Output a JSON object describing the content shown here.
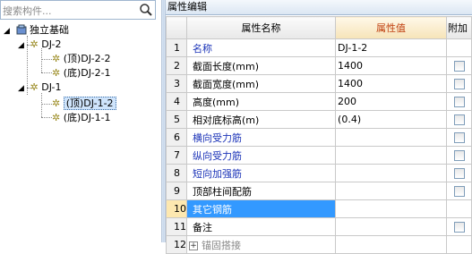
{
  "search": {
    "placeholder": "搜索构件..."
  },
  "tree": {
    "root": "独立基础",
    "groups": [
      {
        "label": "DJ-2",
        "children": [
          "(顶)DJ-2-2",
          "(底)DJ-2-1"
        ]
      },
      {
        "label": "DJ-1",
        "children": [
          "(顶)DJ-1-2",
          "(底)DJ-1-1"
        ]
      }
    ],
    "selected": "(顶)DJ-1-2"
  },
  "panel": {
    "title": "属性编辑"
  },
  "grid": {
    "headers": {
      "name": "属性名称",
      "value": "属性值",
      "extra": "附加"
    },
    "rows": [
      {
        "no": "1",
        "name": "名称",
        "value": "DJ-1-2",
        "style": "blue",
        "check": false
      },
      {
        "no": "2",
        "name": "截面长度(mm)",
        "value": "1400",
        "style": "normal",
        "check": true
      },
      {
        "no": "3",
        "name": "截面宽度(mm)",
        "value": "1400",
        "style": "normal",
        "check": true
      },
      {
        "no": "4",
        "name": "高度(mm)",
        "value": "200",
        "style": "normal",
        "check": true
      },
      {
        "no": "5",
        "name": "相对底标高(m)",
        "value": "(0.4)",
        "style": "normal",
        "check": true
      },
      {
        "no": "6",
        "name": "横向受力筋",
        "value": "",
        "style": "blue",
        "check": true
      },
      {
        "no": "7",
        "name": "纵向受力筋",
        "value": "",
        "style": "blue",
        "check": true
      },
      {
        "no": "8",
        "name": "短向加强筋",
        "value": "",
        "style": "blue",
        "check": true
      },
      {
        "no": "9",
        "name": "顶部柱间配筋",
        "value": "",
        "style": "normal",
        "check": true
      },
      {
        "no": "10",
        "name": "其它钢筋",
        "value": "",
        "style": "normal",
        "check": false
      },
      {
        "no": "11",
        "name": "备注",
        "value": "",
        "style": "normal",
        "check": true
      },
      {
        "no": "12",
        "name": "锚固搭接",
        "value": "",
        "style": "gray",
        "check": false
      }
    ]
  },
  "colors": {
    "accent": "#3399ff",
    "value_header": "#c04010",
    "link_text": "#1c34b8"
  }
}
